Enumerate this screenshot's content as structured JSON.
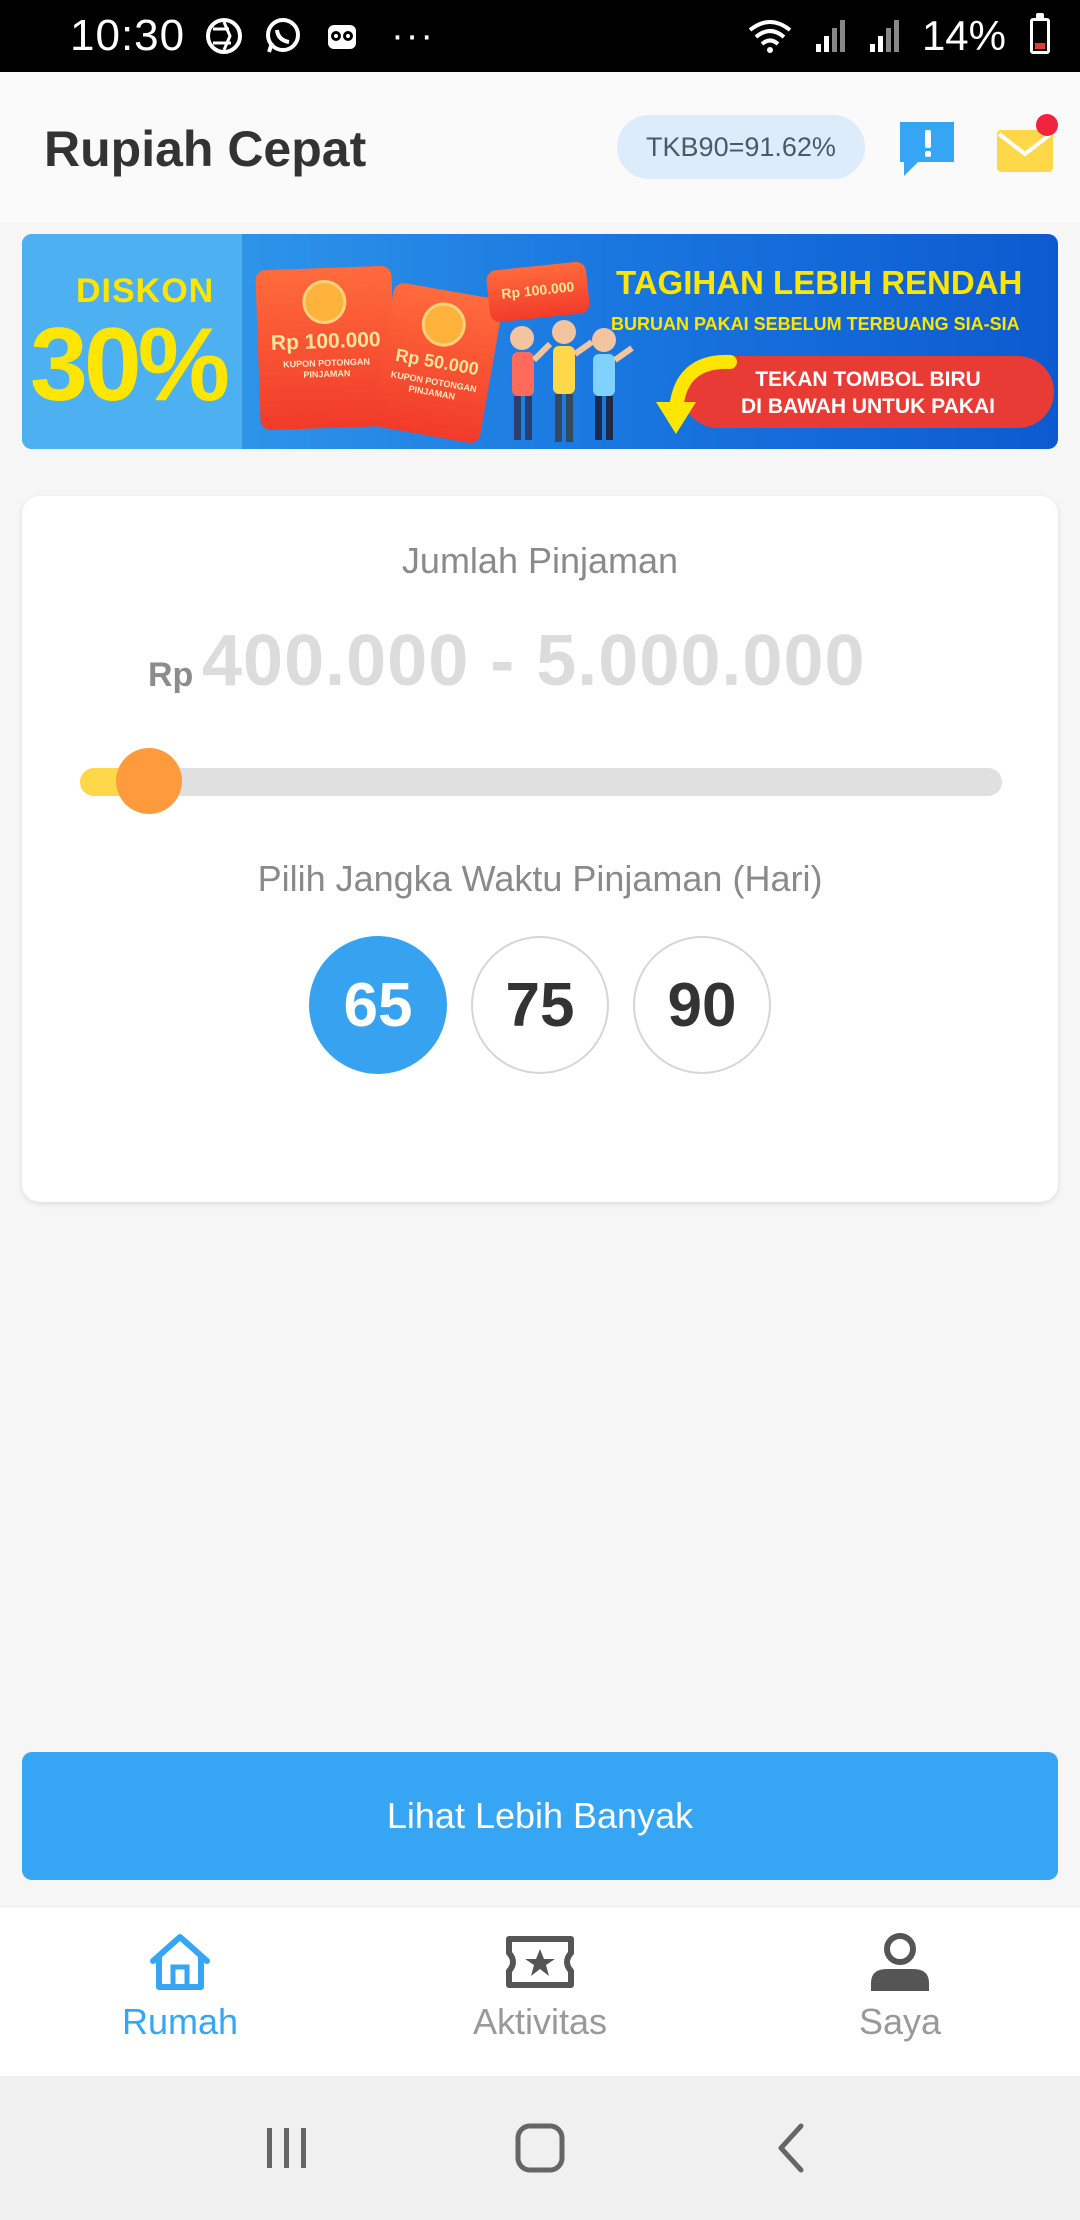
{
  "status_bar": {
    "time": "10:30",
    "dots": "···",
    "battery": "14%",
    "icons": [
      "aperture-icon",
      "whatsapp-icon",
      "owl-icon",
      "wifi-icon",
      "signal-icon",
      "signal-icon",
      "battery-icon"
    ]
  },
  "header": {
    "title": "Rupiah Cepat",
    "tkb_badge": "TKB90=91.62%",
    "help_icon": "chat-alert-icon",
    "mail_icon": "mail-icon",
    "mail_has_notification": true
  },
  "banner": {
    "diskon": "DISKON",
    "percent": "30%",
    "coupon1_amount": "Rp 100.000",
    "coupon1_note": "KUPON POTONGAN PINJAMAN",
    "coupon2_amount": "Rp 50.000",
    "coupon2_note": "KUPON POTONGAN PINJAMAN",
    "coupon3_amount": "Rp 100.000",
    "headline": "TAGIHAN LEBIH RENDAH",
    "subline": "BURUAN PAKAI SEBELUM TERBUANG SIA-SIA",
    "cta_line1": "TEKAN TOMBOL BIRU",
    "cta_line2": "DI BAWAH UNTUK PAKAI"
  },
  "loan": {
    "label": "Jumlah Pinjaman",
    "currency": "Rp",
    "range": "400.000 - 5.000.000",
    "term_label": "Pilih Jangka Waktu Pinjaman (Hari)",
    "terms": [
      "65",
      "75",
      "90"
    ],
    "selected_term": "65"
  },
  "primary_button": "Lihat Lebih Banyak",
  "bottom_nav": {
    "items": [
      {
        "label": "Rumah",
        "icon": "home-icon",
        "active": true
      },
      {
        "label": "Aktivitas",
        "icon": "ticket-icon",
        "active": false
      },
      {
        "label": "Saya",
        "icon": "user-icon",
        "active": false
      }
    ]
  },
  "colors": {
    "accent": "#36a6f4",
    "slider_thumb": "#ff9b3d",
    "slider_fill": "#ffd84a",
    "mail": "#ffd84a",
    "notification": "#f0243c"
  }
}
